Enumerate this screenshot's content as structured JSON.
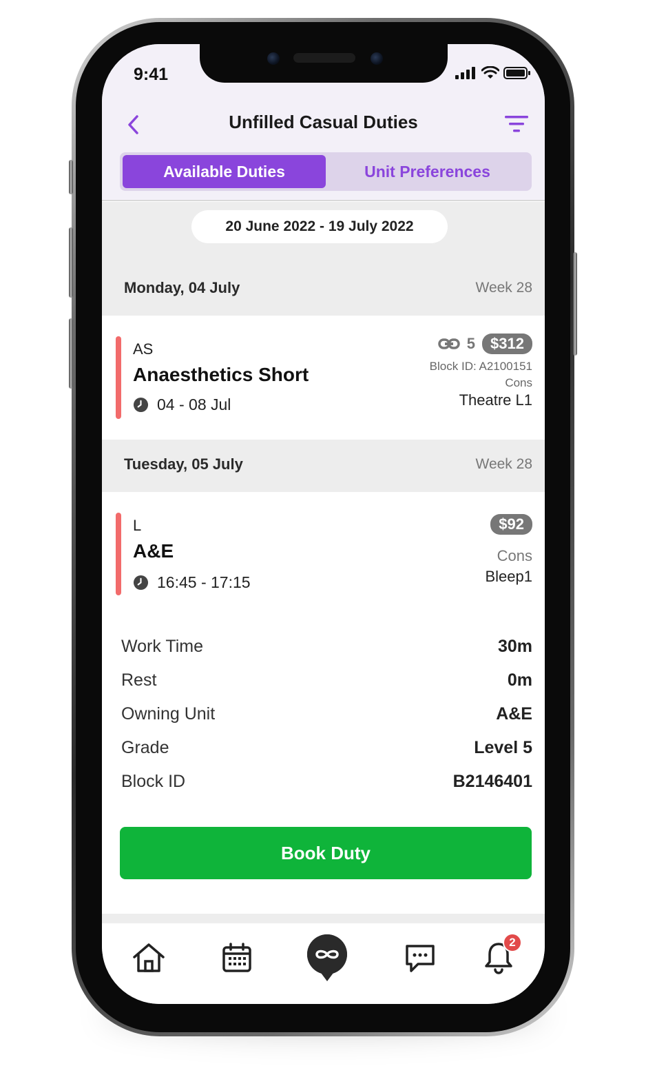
{
  "status_bar": {
    "time": "9:41"
  },
  "header": {
    "title": "Unfilled Casual Duties",
    "tabs": [
      {
        "label": "Available Duties",
        "active": true
      },
      {
        "label": "Unit Preferences",
        "active": false
      }
    ]
  },
  "date_range": "20 June 2022 - 19 July 2022",
  "days": [
    {
      "day": "Monday, 04 July",
      "week": "Week 28",
      "duty": {
        "code": "AS",
        "name": "Anaesthetics Short",
        "time": "04 - 08 Jul",
        "link_count": "5",
        "price": "$312",
        "block": "Block ID: A2100151",
        "grade": "Cons",
        "location": "Theatre L1"
      }
    },
    {
      "day": "Tuesday, 05 July",
      "week": "Week 28",
      "duty": {
        "code": "L",
        "name": "A&E",
        "time": "16:45 - 17:15",
        "price": "$92",
        "grade": "Cons",
        "location": "Bleep1",
        "details": [
          {
            "label": "Work Time",
            "value": "30m"
          },
          {
            "label": "Rest",
            "value": "0m"
          },
          {
            "label": "Owning Unit",
            "value": "A&E"
          },
          {
            "label": "Grade",
            "value": "Level 5"
          },
          {
            "label": "Block ID",
            "value": "B2146401"
          }
        ],
        "action": "Book Duty"
      }
    }
  ],
  "tabbar": {
    "items": [
      "home-icon",
      "calendar-icon",
      "app-logo-icon",
      "chat-icon",
      "bell-icon"
    ],
    "notification_count": "2"
  },
  "colors": {
    "accent": "#8a45dc",
    "book": "#0fb43a",
    "duty_bar": "#f26b6b",
    "badge": "#e24a4a"
  }
}
